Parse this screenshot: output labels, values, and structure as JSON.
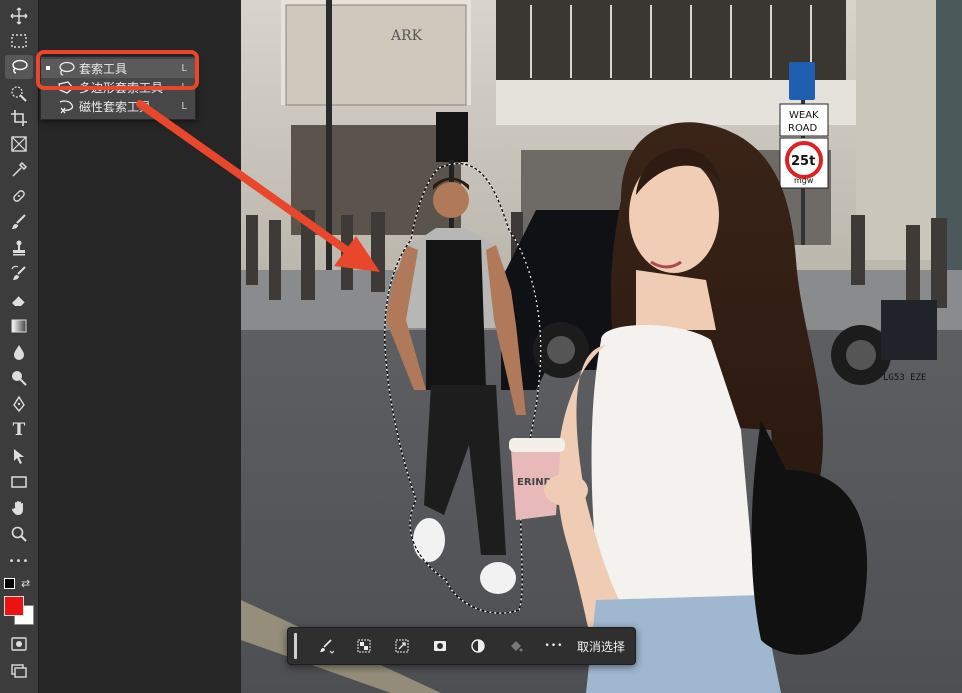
{
  "flyout": {
    "items": [
      {
        "label": "套索工具",
        "shortcut": "L",
        "icon": "lasso-icon"
      },
      {
        "label": "多边形套索工具",
        "shortcut": "L",
        "icon": "polygonal-lasso-icon"
      },
      {
        "label": "磁性套索工具",
        "shortcut": "L",
        "icon": "magnetic-lasso-icon"
      }
    ]
  },
  "toolbar": {
    "tools": [
      "move-tool",
      "marquee-tool",
      "lasso-tool",
      "quick-select-tool",
      "crop-tool",
      "frame-tool",
      "eyedropper-tool",
      "healing-brush-tool",
      "brush-tool",
      "clone-stamp-tool",
      "history-brush-tool",
      "eraser-tool",
      "gradient-tool",
      "blur-tool",
      "dodge-tool",
      "pen-tool",
      "type-tool",
      "path-select-tool",
      "rectangle-tool",
      "hand-tool",
      "zoom-tool",
      "more-tools"
    ],
    "type_glyph": "T",
    "more_glyph": "•••",
    "foreground_color": "#ee1111",
    "background_color": "#ffffff"
  },
  "photo": {
    "store_sign": "ARK",
    "road_sign_weak": "WEAK",
    "road_sign_road": "ROAD",
    "speed_limit": "25t",
    "speed_unit": "mgw",
    "cup_text": "ERIND",
    "plate": "LG53 EZE"
  },
  "context_bar": {
    "deselect_label": "取消选择",
    "more_glyph": "•••"
  },
  "colors": {
    "accent": "#e8472b",
    "toolbar": "#3c3c3c",
    "canvas": "#262626"
  }
}
